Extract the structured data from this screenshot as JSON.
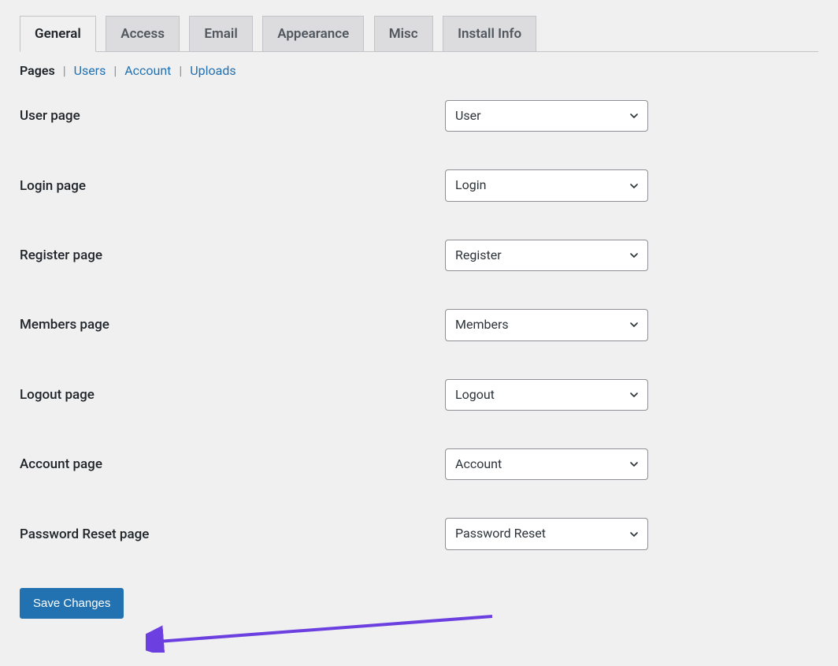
{
  "tabs": [
    {
      "label": "General",
      "active": true
    },
    {
      "label": "Access",
      "active": false
    },
    {
      "label": "Email",
      "active": false
    },
    {
      "label": "Appearance",
      "active": false
    },
    {
      "label": "Misc",
      "active": false
    },
    {
      "label": "Install Info",
      "active": false
    }
  ],
  "subnav": [
    {
      "label": "Pages",
      "active": true
    },
    {
      "label": "Users",
      "active": false
    },
    {
      "label": "Account",
      "active": false
    },
    {
      "label": "Uploads",
      "active": false
    }
  ],
  "fields": [
    {
      "label": "User page",
      "value": "User"
    },
    {
      "label": "Login page",
      "value": "Login"
    },
    {
      "label": "Register page",
      "value": "Register"
    },
    {
      "label": "Members page",
      "value": "Members"
    },
    {
      "label": "Logout page",
      "value": "Logout"
    },
    {
      "label": "Account page",
      "value": "Account"
    },
    {
      "label": "Password Reset page",
      "value": "Password Reset"
    }
  ],
  "save_button": "Save Changes",
  "colors": {
    "accent": "#2271b1",
    "arrow": "#6b3fe0"
  }
}
